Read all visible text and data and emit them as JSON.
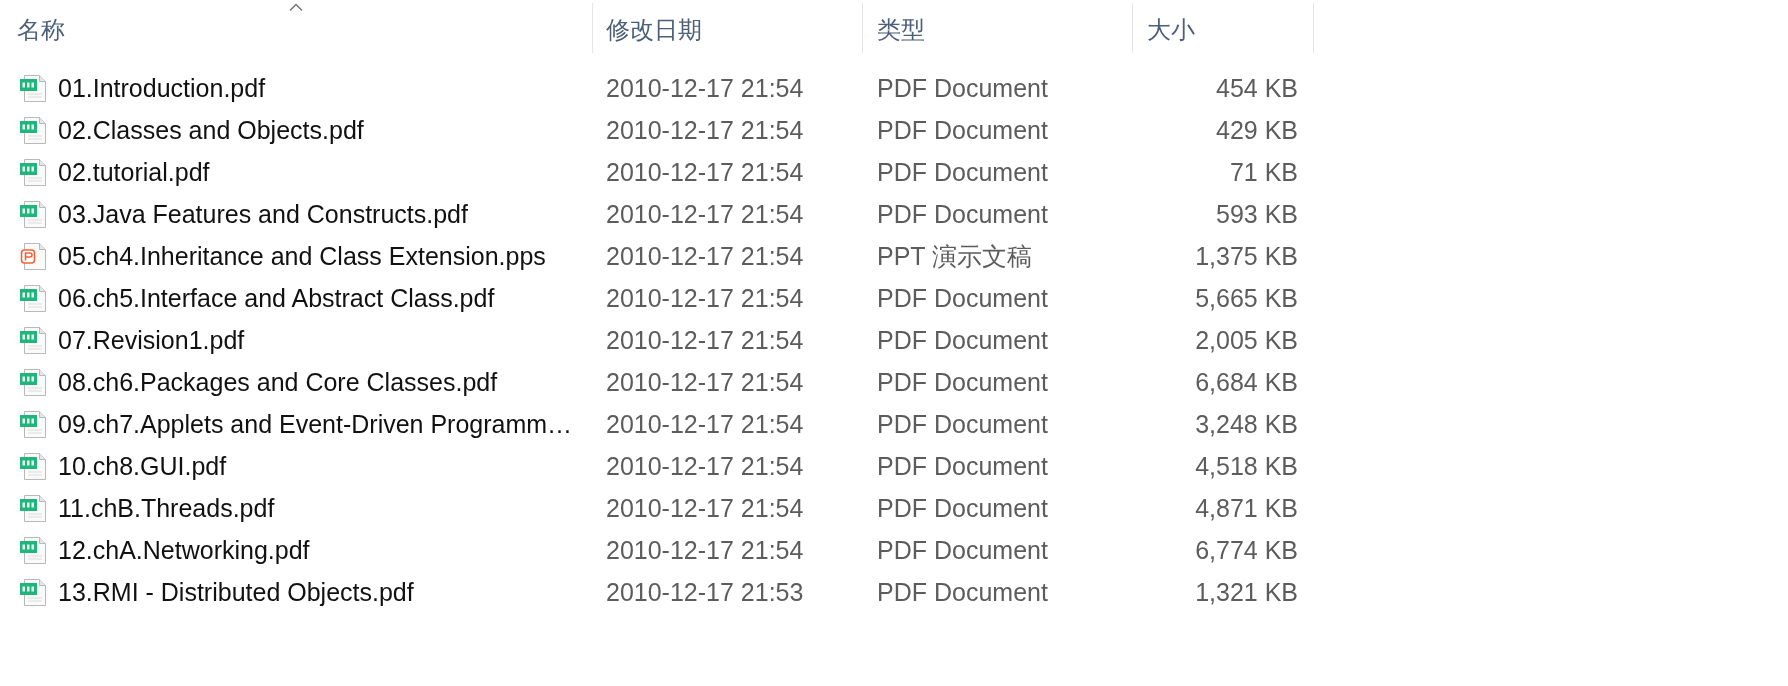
{
  "columns": [
    {
      "label": "名称",
      "sorted": true
    },
    {
      "label": "修改日期",
      "sorted": false
    },
    {
      "label": "类型",
      "sorted": false
    },
    {
      "label": "大小",
      "sorted": false
    }
  ],
  "files": [
    {
      "kind": "pdf",
      "name": "01.Introduction.pdf",
      "modified": "2010-12-17 21:54",
      "type": "PDF Document",
      "size": "454 KB"
    },
    {
      "kind": "pdf",
      "name": "02.Classes and Objects.pdf",
      "modified": "2010-12-17 21:54",
      "type": "PDF Document",
      "size": "429 KB"
    },
    {
      "kind": "pdf",
      "name": "02.tutorial.pdf",
      "modified": "2010-12-17 21:54",
      "type": "PDF Document",
      "size": "71 KB"
    },
    {
      "kind": "pdf",
      "name": "03.Java Features and Constructs.pdf",
      "modified": "2010-12-17 21:54",
      "type": "PDF Document",
      "size": "593 KB"
    },
    {
      "kind": "presentation",
      "name": "05.ch4.Inheritance and Class Extension.pps",
      "modified": "2010-12-17 21:54",
      "type": "PPT 演示文稿",
      "size": "1,375 KB"
    },
    {
      "kind": "pdf",
      "name": "06.ch5.Interface and Abstract Class.pdf",
      "modified": "2010-12-17 21:54",
      "type": "PDF Document",
      "size": "5,665 KB"
    },
    {
      "kind": "pdf",
      "name": "07.Revision1.pdf",
      "modified": "2010-12-17 21:54",
      "type": "PDF Document",
      "size": "2,005 KB"
    },
    {
      "kind": "pdf",
      "name": "08.ch6.Packages and Core Classes.pdf",
      "modified": "2010-12-17 21:54",
      "type": "PDF Document",
      "size": "6,684 KB"
    },
    {
      "kind": "pdf",
      "name": "09.ch7.Applets and Event-Driven Programm…",
      "modified": "2010-12-17 21:54",
      "type": "PDF Document",
      "size": "3,248 KB"
    },
    {
      "kind": "pdf",
      "name": "10.ch8.GUI.pdf",
      "modified": "2010-12-17 21:54",
      "type": "PDF Document",
      "size": "4,518 KB"
    },
    {
      "kind": "pdf",
      "name": "11.chB.Threads.pdf",
      "modified": "2010-12-17 21:54",
      "type": "PDF Document",
      "size": "4,871 KB"
    },
    {
      "kind": "pdf",
      "name": "12.chA.Networking.pdf",
      "modified": "2010-12-17 21:54",
      "type": "PDF Document",
      "size": "6,774 KB"
    },
    {
      "kind": "pdf",
      "name": "13.RMI - Distributed Objects.pdf",
      "modified": "2010-12-17 21:53",
      "type": "PDF Document",
      "size": "1,321 KB"
    }
  ]
}
